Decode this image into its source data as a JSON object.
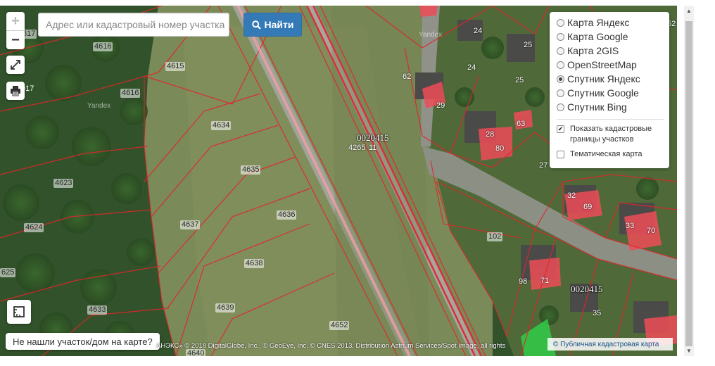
{
  "search": {
    "placeholder": "Адрес или кадастровый номер участка",
    "button_label": "Найти"
  },
  "controls": {
    "zoom_in": "+",
    "zoom_out": "−"
  },
  "layers": {
    "options": [
      {
        "label": "Карта Яндекс",
        "selected": false
      },
      {
        "label": "Карта Google",
        "selected": false
      },
      {
        "label": "Карта 2GIS",
        "selected": false
      },
      {
        "label": "OpenStreetMap",
        "selected": false
      },
      {
        "label": "Спутник Яндекс",
        "selected": true
      },
      {
        "label": "Спутник Google",
        "selected": false
      },
      {
        "label": "Спутник Bing",
        "selected": false
      }
    ],
    "checkboxes": [
      {
        "label": "Показать кадастровые границы участков",
        "checked": true
      },
      {
        "label": "Тематическая карта",
        "checked": false
      }
    ]
  },
  "not_found_button": "Не нашли участок/дом на карте?",
  "attribution": "АНЭКС» © 2018 DigitalGlobe, Inc., © GeoEye, Inc, © CNES 2013, Distribution Astrium Services/Spot Image, all rights",
  "public_map_link": "© Публичная кадастровая карта",
  "watermark": "Yandex",
  "map": {
    "plot_labels": [
      "617",
      "4616",
      "4615",
      "4616",
      "4634",
      "4635",
      "4636",
      "4637",
      "4638",
      "4639",
      "4623",
      "4624",
      "625",
      "4633",
      "4652",
      "4640",
      "4265",
      "11",
      "102",
      "017"
    ],
    "house_numbers": [
      "24",
      "25",
      "24",
      "25",
      "29",
      "28",
      "80",
      "27",
      "32",
      "69",
      "33",
      "70",
      "98",
      "71",
      "35",
      "52",
      "62",
      "63"
    ],
    "quarter_labels": [
      "0020415",
      "0020415"
    ]
  }
}
